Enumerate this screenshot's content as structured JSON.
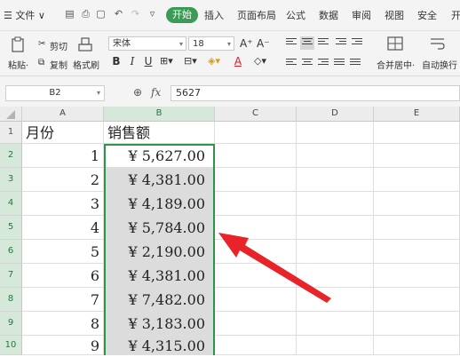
{
  "menubar": {
    "file_label": "☰ 文件 ∨",
    "tabs": [
      "开始",
      "插入",
      "页面布局",
      "公式",
      "数据",
      "审阅",
      "视图",
      "安全",
      "开"
    ]
  },
  "toolbar": {
    "paste_label": "粘贴·",
    "cut_label": "剪切",
    "copy_label": "复制",
    "format_painter_label": "格式刷",
    "font_name": "宋体",
    "font_size": "18",
    "merge_label": "合并居中·",
    "wrap_label": "自动换行",
    "bold": "B",
    "italic": "I",
    "underline": "U"
  },
  "formula_bar": {
    "name_box": "B2",
    "fx": "fx",
    "value": "5627"
  },
  "columns": [
    "A",
    "B",
    "C",
    "D",
    "E"
  ],
  "rows": [
    {
      "n": "1",
      "a": "月份",
      "b": "销售额"
    },
    {
      "n": "2",
      "a": "1",
      "b": "¥ 5,627.00"
    },
    {
      "n": "3",
      "a": "2",
      "b": "¥ 4,381.00"
    },
    {
      "n": "4",
      "a": "3",
      "b": "¥ 4,189.00"
    },
    {
      "n": "5",
      "a": "4",
      "b": "¥ 5,784.00"
    },
    {
      "n": "6",
      "a": "5",
      "b": "¥ 2,190.00"
    },
    {
      "n": "7",
      "a": "6",
      "b": "¥ 4,381.00"
    },
    {
      "n": "8",
      "a": "7",
      "b": "¥ 7,482.00"
    },
    {
      "n": "9",
      "a": "8",
      "b": "¥ 3,183.00"
    },
    {
      "n": "10",
      "a": "9",
      "b": "¥ 4,315.00"
    }
  ],
  "colors": {
    "accent": "#3c9a57",
    "selection": "#2e9447",
    "arrow": "#e8242a"
  }
}
